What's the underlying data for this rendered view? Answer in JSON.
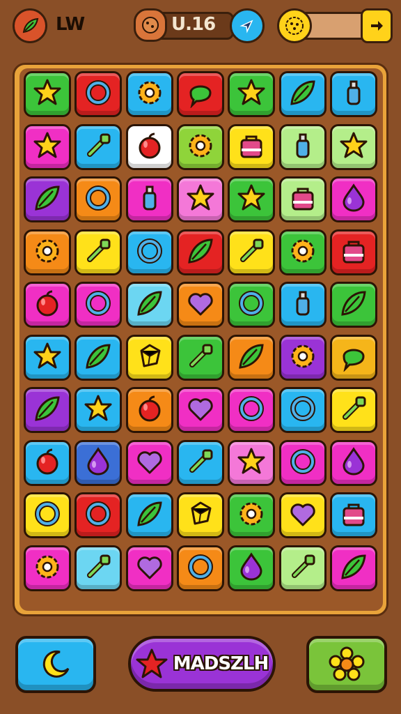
{
  "hud": {
    "left_value": "LW",
    "center_value": "U.16",
    "right_arrow": "arrow-right-icon"
  },
  "board": {
    "rows": 10,
    "cols": 7,
    "tiles": [
      [
        {
          "c": "#3cc43a",
          "i": "star"
        },
        {
          "c": "#e42323",
          "i": "ring"
        },
        {
          "c": "#29b6f0",
          "i": "gear"
        },
        {
          "c": "#e42323",
          "i": "bubble"
        },
        {
          "c": "#3cc43a",
          "i": "star"
        },
        {
          "c": "#29b6f0",
          "i": "leaf"
        },
        {
          "c": "#29b6f0",
          "i": "bottle"
        }
      ],
      [
        {
          "c": "#f02fc4",
          "i": "star"
        },
        {
          "c": "#29b6f0",
          "i": "key"
        },
        {
          "c": "#ffffff",
          "i": "apple"
        },
        {
          "c": "#8fd43a",
          "i": "gear"
        },
        {
          "c": "#ffe11a",
          "i": "bag"
        },
        {
          "c": "#b4ee8a",
          "i": "bottle"
        },
        {
          "c": "#b4ee8a",
          "i": "star"
        }
      ],
      [
        {
          "c": "#9a33d6",
          "i": "leaf"
        },
        {
          "c": "#f58a17",
          "i": "ring"
        },
        {
          "c": "#f02fc4",
          "i": "bottle"
        },
        {
          "c": "#f478d8",
          "i": "star"
        },
        {
          "c": "#3cc43a",
          "i": "star"
        },
        {
          "c": "#b4ee8a",
          "i": "bag"
        },
        {
          "c": "#f02fc4",
          "i": "drop"
        }
      ],
      [
        {
          "c": "#f58a17",
          "i": "gear"
        },
        {
          "c": "#ffe11a",
          "i": "key"
        },
        {
          "c": "#29b6f0",
          "i": "ring"
        },
        {
          "c": "#e42323",
          "i": "leaf"
        },
        {
          "c": "#ffe11a",
          "i": "key"
        },
        {
          "c": "#3cc43a",
          "i": "gear"
        },
        {
          "c": "#e42323",
          "i": "bag"
        }
      ],
      [
        {
          "c": "#f02fc4",
          "i": "apple"
        },
        {
          "c": "#f02fc4",
          "i": "ring"
        },
        {
          "c": "#6cd6f2",
          "i": "leaf"
        },
        {
          "c": "#f58a17",
          "i": "heart"
        },
        {
          "c": "#3cc43a",
          "i": "ring"
        },
        {
          "c": "#29b6f0",
          "i": "bottle"
        },
        {
          "c": "#3cc43a",
          "i": "leaf"
        }
      ],
      [
        {
          "c": "#29b6f0",
          "i": "star"
        },
        {
          "c": "#29b6f0",
          "i": "leaf"
        },
        {
          "c": "#ffe11a",
          "i": "gem"
        },
        {
          "c": "#3cc43a",
          "i": "key"
        },
        {
          "c": "#f58a17",
          "i": "leaf"
        },
        {
          "c": "#9a33d6",
          "i": "gear"
        },
        {
          "c": "#f5b51a",
          "i": "bubble"
        }
      ],
      [
        {
          "c": "#9a33d6",
          "i": "leaf"
        },
        {
          "c": "#29b6f0",
          "i": "star"
        },
        {
          "c": "#f58a17",
          "i": "apple"
        },
        {
          "c": "#f02fc4",
          "i": "heart"
        },
        {
          "c": "#f02fc4",
          "i": "ring"
        },
        {
          "c": "#29b6f0",
          "i": "ring"
        },
        {
          "c": "#ffe11a",
          "i": "key"
        }
      ],
      [
        {
          "c": "#29b6f0",
          "i": "apple"
        },
        {
          "c": "#3b6fd6",
          "i": "drop"
        },
        {
          "c": "#f02fc4",
          "i": "heart"
        },
        {
          "c": "#29b6f0",
          "i": "key"
        },
        {
          "c": "#f478d8",
          "i": "star"
        },
        {
          "c": "#f02fc4",
          "i": "ring"
        },
        {
          "c": "#f02fc4",
          "i": "drop"
        }
      ],
      [
        {
          "c": "#ffe11a",
          "i": "ring"
        },
        {
          "c": "#e42323",
          "i": "ring"
        },
        {
          "c": "#29b6f0",
          "i": "leaf"
        },
        {
          "c": "#ffe11a",
          "i": "gem"
        },
        {
          "c": "#3cc43a",
          "i": "gear"
        },
        {
          "c": "#ffe11a",
          "i": "heart"
        },
        {
          "c": "#29b6f0",
          "i": "bag"
        }
      ],
      [
        {
          "c": "#f02fc4",
          "i": "gear"
        },
        {
          "c": "#6cd6f2",
          "i": "key"
        },
        {
          "c": "#f02fc4",
          "i": "heart"
        },
        {
          "c": "#f58a17",
          "i": "ring"
        },
        {
          "c": "#3cc43a",
          "i": "drop"
        },
        {
          "c": "#b4ee8a",
          "i": "key"
        },
        {
          "c": "#f02fc4",
          "i": "leaf"
        }
      ]
    ]
  },
  "footer": {
    "left_icon": "moon-icon",
    "play_label": "MADSZLH",
    "right_icon": "flower-icon"
  }
}
